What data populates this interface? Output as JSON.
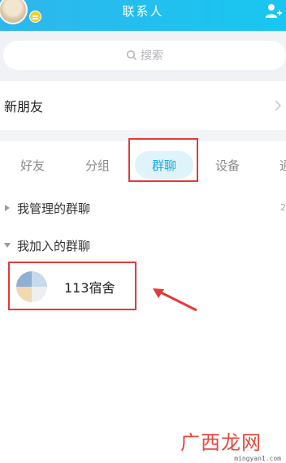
{
  "header": {
    "title": "联系人",
    "accent_color": "#21bdee",
    "avatar_icon": "user-avatar",
    "right_icon": "add-contact-icon"
  },
  "search": {
    "placeholder": "搜索",
    "icon": "search-icon"
  },
  "new_friends": {
    "label": "新朋友",
    "icon": "chevron-right-icon"
  },
  "tabs": [
    {
      "label": "好友",
      "active": false
    },
    {
      "label": "分组",
      "active": false
    },
    {
      "label": "群聊",
      "active": true
    },
    {
      "label": "设备",
      "active": false
    },
    {
      "label": "通",
      "active": false
    }
  ],
  "groups": {
    "managed": {
      "label": "我管理的群聊",
      "count": "2",
      "expanded": false
    },
    "joined": {
      "label": "我加入的群聊",
      "expanded": true,
      "items": [
        {
          "name": "113宿舍"
        }
      ]
    }
  },
  "annotation": {
    "highlight_color": "#e23a3a"
  },
  "watermark": {
    "text": "广西龙网",
    "url": "mingyan1.com"
  }
}
